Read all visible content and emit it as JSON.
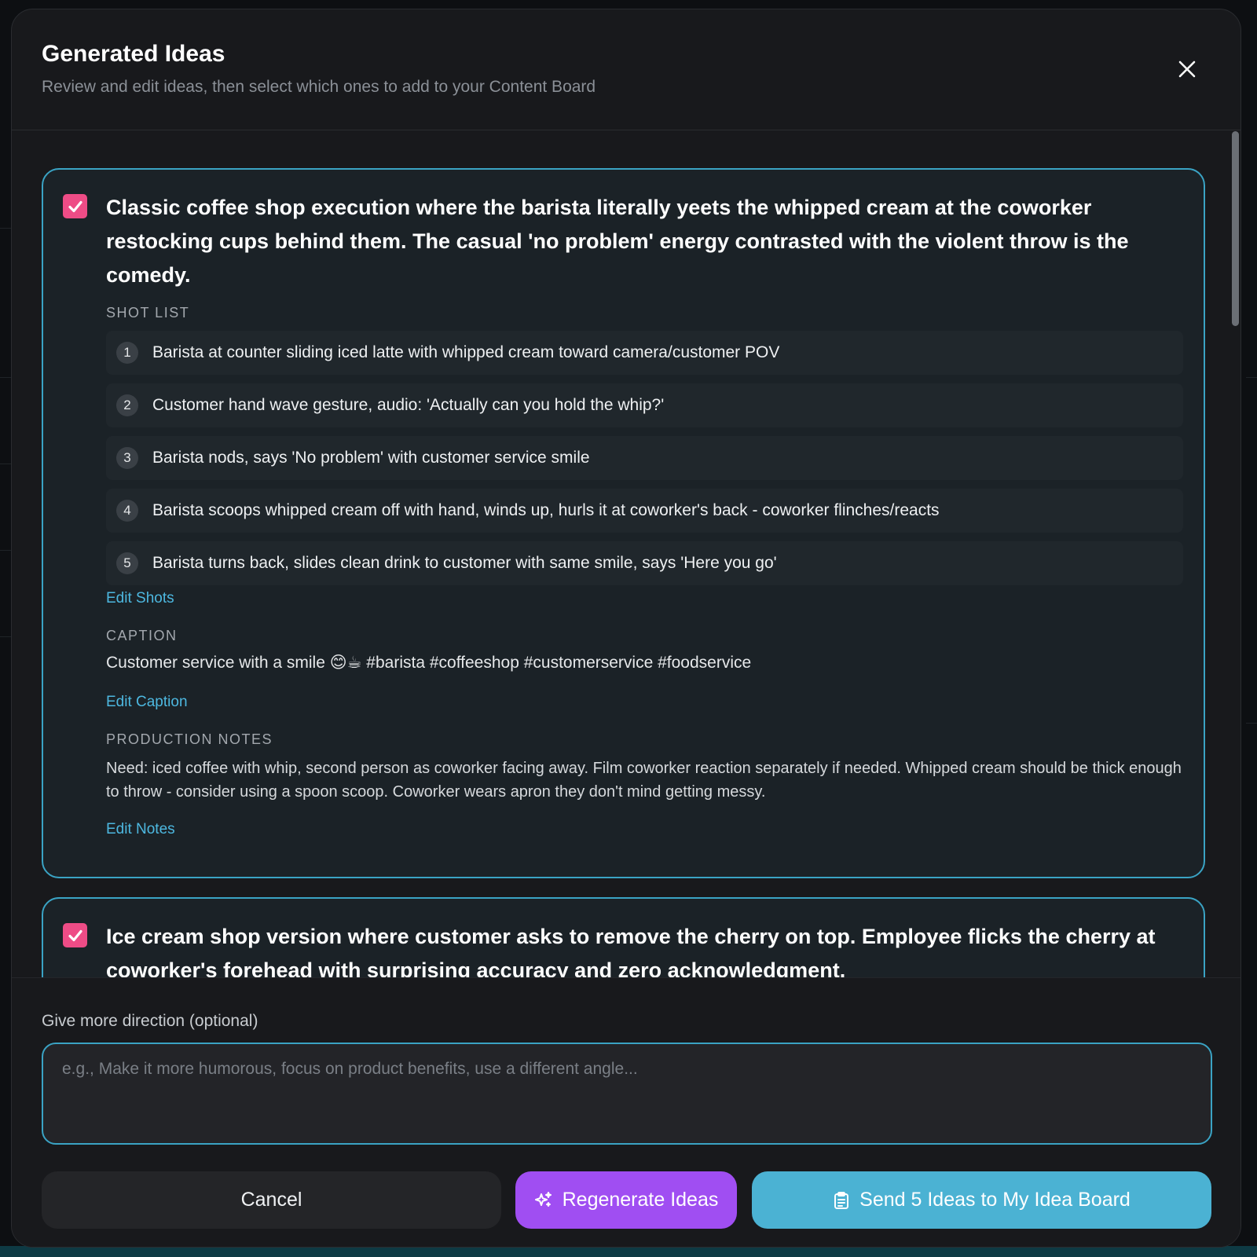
{
  "dialog": {
    "title": "Generated Ideas",
    "subtitle": "Review and edit ideas, then select which ones to add to your Content Board",
    "close_icon": "close-icon"
  },
  "ideas": [
    {
      "checked": true,
      "title": "Classic coffee shop execution where the barista literally yeets the whipped cream at the coworker restocking cups behind them. The casual 'no problem' energy contrasted with the violent throw is the comedy.",
      "shot_list_label": "SHOT LIST",
      "shots": [
        {
          "num": "1",
          "text": "Barista at counter sliding iced latte with whipped cream toward camera/customer POV"
        },
        {
          "num": "2",
          "text": "Customer hand wave gesture, audio: 'Actually can you hold the whip?'"
        },
        {
          "num": "3",
          "text": "Barista nods, says 'No problem' with customer service smile"
        },
        {
          "num": "4",
          "text": "Barista scoops whipped cream off with hand, winds up, hurls it at coworker's back - coworker flinches/reacts"
        },
        {
          "num": "5",
          "text": "Barista turns back, slides clean drink to customer with same smile, says 'Here you go'"
        }
      ],
      "edit_shots_label": "Edit Shots",
      "caption_label": "CAPTION",
      "caption": "Customer service with a smile 😊☕ #barista #coffeeshop #customerservice #foodservice",
      "edit_caption_label": "Edit Caption",
      "notes_label": "PRODUCTION NOTES",
      "notes": "Need: iced coffee with whip, second person as coworker facing away. Film coworker reaction separately if needed. Whipped cream should be thick enough to throw - consider using a spoon scoop. Coworker wears apron they don't mind getting messy.",
      "edit_notes_label": "Edit Notes"
    },
    {
      "checked": true,
      "title": "Ice cream shop version where customer asks to remove the cherry on top. Employee flicks the cherry at coworker's forehead with surprising accuracy and zero acknowledgment."
    }
  ],
  "direction": {
    "label": "Give more direction (optional)",
    "placeholder": "e.g., Make it more humorous, focus on product benefits, use a different angle...",
    "value": ""
  },
  "actions": {
    "cancel_label": "Cancel",
    "regenerate_label": "Regenerate Ideas",
    "regenerate_icon": "sparkles-icon",
    "send_label": "Send 5 Ideas to My Idea Board",
    "send_icon": "clipboard-icon"
  },
  "colors": {
    "accent_cyan": "#4bb2d3",
    "accent_purple": "#a04ef2",
    "checkbox_pink": "#ee4c86"
  }
}
